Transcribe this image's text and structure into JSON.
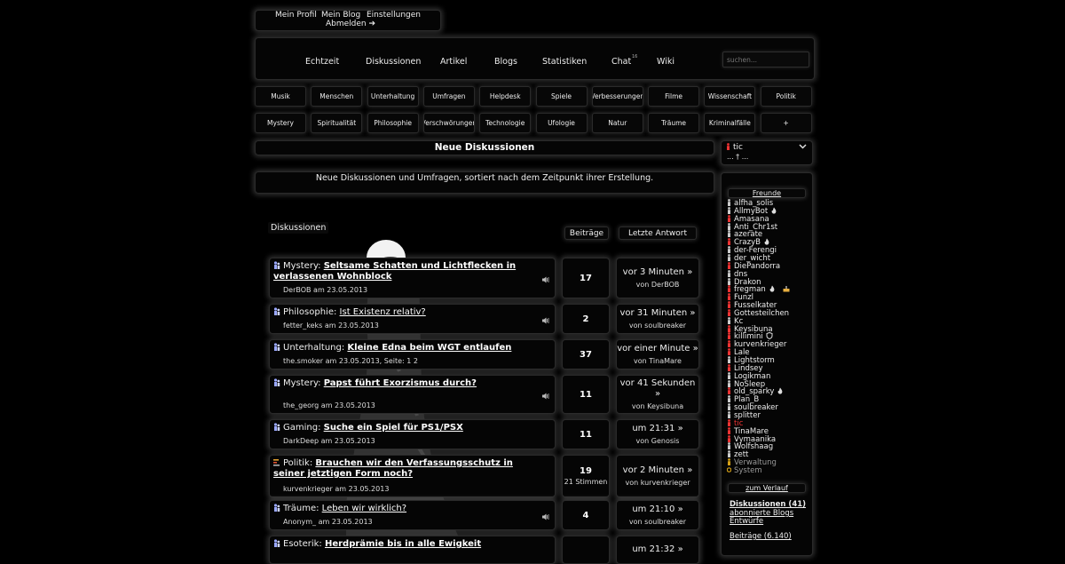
{
  "colors": {
    "background": "#000000",
    "text": "#dddddd",
    "online": "#ee3333",
    "away": "#d4a017",
    "offline": "#cccccc"
  },
  "top_menu": {
    "profile": "Mein Profil",
    "blog": "Mein Blog",
    "settings": "Einstellungen",
    "logout": "Abmelden ➔"
  },
  "main_nav": {
    "items": [
      "Echtzeit",
      "Diskussionen",
      "Artikel",
      "Blogs",
      "Statistiken",
      "Chat",
      "Wiki"
    ],
    "chat_badge": "16",
    "search_placeholder": "suchen..."
  },
  "categories_row1": [
    "Musik",
    "Menschen",
    "Unterhaltung",
    "Umfragen",
    "Helpdesk",
    "Spiele",
    "Verbesserungen",
    "Filme",
    "Wissenschaft",
    "Politik"
  ],
  "categories_row2": [
    "Mystery",
    "Spiritualität",
    "Philosophie",
    "Verschwörungen",
    "Technologie",
    "Ufologie",
    "Natur",
    "Träume",
    "Kriminalfälle",
    "+"
  ],
  "page": {
    "title": "Neue Diskussionen",
    "description": "Neue Diskussionen und Umfragen, sortiert nach dem Zeitpunkt ihrer Erstellung."
  },
  "table": {
    "col_discussions": "Diskussionen",
    "col_posts": "Beiträge",
    "col_last": "Letzte Antwort"
  },
  "threads": [
    {
      "icon": "discussion",
      "cat": "Mystery:",
      "title": "Seltsame Schatten und Lichtflecken in verlassenen Wohnblock",
      "by": "DerBOB am 23.05.2013",
      "posts": "17",
      "last": "vor 3 Minuten »",
      "last_by": "von DerBOB",
      "bell": true
    },
    {
      "icon": "discussion",
      "cat": "Philosophie:",
      "title": "Ist Existenz relativ?",
      "by": "fetter_keks am 23.05.2013",
      "posts": "2",
      "last": "vor 31 Minuten »",
      "last_by": "von soulbreaker",
      "bell": true
    },
    {
      "icon": "discussion",
      "cat": "Unterhaltung:",
      "title": "Kleine Edna beim WGT entlaufen",
      "by": "the.smoker am 23.05.2013, Seite: 1 2",
      "posts": "37",
      "last": "vor einer Minute »",
      "last_by": "von TinaMare",
      "bell": false
    },
    {
      "icon": "discussion",
      "cat": "Mystery:",
      "title": "Papst führt Exorzismus durch?",
      "by": "the_georg am 23.05.2013",
      "posts": "11",
      "last": "vor 41 Sekunden »",
      "last_by": "von Keysibuna",
      "bell": true
    },
    {
      "icon": "discussion",
      "cat": "Gaming:",
      "title": "Suche ein Spiel für PS1/PSX",
      "by": "DarkDeep am 23.05.2013",
      "posts": "11",
      "last": "um 21:31 »",
      "last_by": "von Genosis",
      "bell": false
    },
    {
      "icon": "poll",
      "cat": "Politik:",
      "title": "Brauchen wir den Verfassungsschutz in seiner jetztigen Form noch?",
      "by": "kurvenkrieger am 23.05.2013",
      "posts": "19",
      "votes": "21 Stimmen",
      "last": "vor 2 Minuten »",
      "last_by": "von kurvenkrieger",
      "bell": false
    },
    {
      "icon": "discussion",
      "cat": "Träume:",
      "title": "Leben wir wirklich?",
      "by": "Anonym_ am 23.05.2013",
      "posts": "4",
      "last": "um 21:10 »",
      "last_by": "von soulbreaker",
      "bell": true
    },
    {
      "icon": "discussion",
      "cat": "Esoterik:",
      "title": "Herdprämie bis in alle Ewigkeit",
      "by": "",
      "posts": "",
      "last": "um 21:32 »",
      "last_by": "",
      "bell": false
    }
  ],
  "user": {
    "name": "tic",
    "status": "... † ..."
  },
  "friends_title": "Freunde",
  "friends": [
    {
      "name": "alfha_solis",
      "state": "offline"
    },
    {
      "name": "AllmyBot",
      "state": "offline",
      "icon": "flame"
    },
    {
      "name": "Amasana",
      "state": "online"
    },
    {
      "name": "Anti_Chr1st",
      "state": "offline"
    },
    {
      "name": "azerate",
      "state": "offline"
    },
    {
      "name": "CrazyB",
      "state": "online",
      "icon": "flame"
    },
    {
      "name": "der-Ferengi",
      "state": "offline"
    },
    {
      "name": "der_wicht",
      "state": "offline"
    },
    {
      "name": "DiePandorra",
      "state": "online"
    },
    {
      "name": "dns",
      "state": "offline"
    },
    {
      "name": "Drakon",
      "state": "offline"
    },
    {
      "name": "fregman",
      "state": "online",
      "icon": "flame",
      "icon2": "cake"
    },
    {
      "name": "Funzl",
      "state": "online"
    },
    {
      "name": "Fusselkater",
      "state": "online"
    },
    {
      "name": "Gottesteilchen",
      "state": "online"
    },
    {
      "name": "Kc",
      "state": "offline"
    },
    {
      "name": "Keysibuna",
      "state": "online"
    },
    {
      "name": "killimini",
      "state": "online",
      "icon": "shield"
    },
    {
      "name": "kurvenkrieger",
      "state": "online"
    },
    {
      "name": "Lale",
      "state": "online"
    },
    {
      "name": "Lightstorm",
      "state": "offline"
    },
    {
      "name": "Lindsey",
      "state": "online"
    },
    {
      "name": "Logikman",
      "state": "offline"
    },
    {
      "name": "NoSleep",
      "state": "offline"
    },
    {
      "name": "old_sparky",
      "state": "online",
      "icon": "flame"
    },
    {
      "name": "Plan_B",
      "state": "offline"
    },
    {
      "name": "soulbreaker",
      "state": "offline"
    },
    {
      "name": "splitter",
      "state": "offline"
    },
    {
      "name": "tic",
      "state": "self"
    },
    {
      "name": "TinaMare",
      "state": "online"
    },
    {
      "name": "Vymaanika",
      "state": "online"
    },
    {
      "name": "Wolfshaag",
      "state": "offline"
    },
    {
      "name": "zett",
      "state": "offline"
    },
    {
      "name": "Verwaltung",
      "state": "away"
    },
    {
      "name": "System",
      "state": "system"
    }
  ],
  "history_link": "zum Verlauf",
  "side_links": {
    "discussions": "Diskussionen (41)",
    "subscribed": "abonnierte Blogs",
    "drafts": "Entwürfe",
    "posts": "Beiträge (6.140)"
  }
}
